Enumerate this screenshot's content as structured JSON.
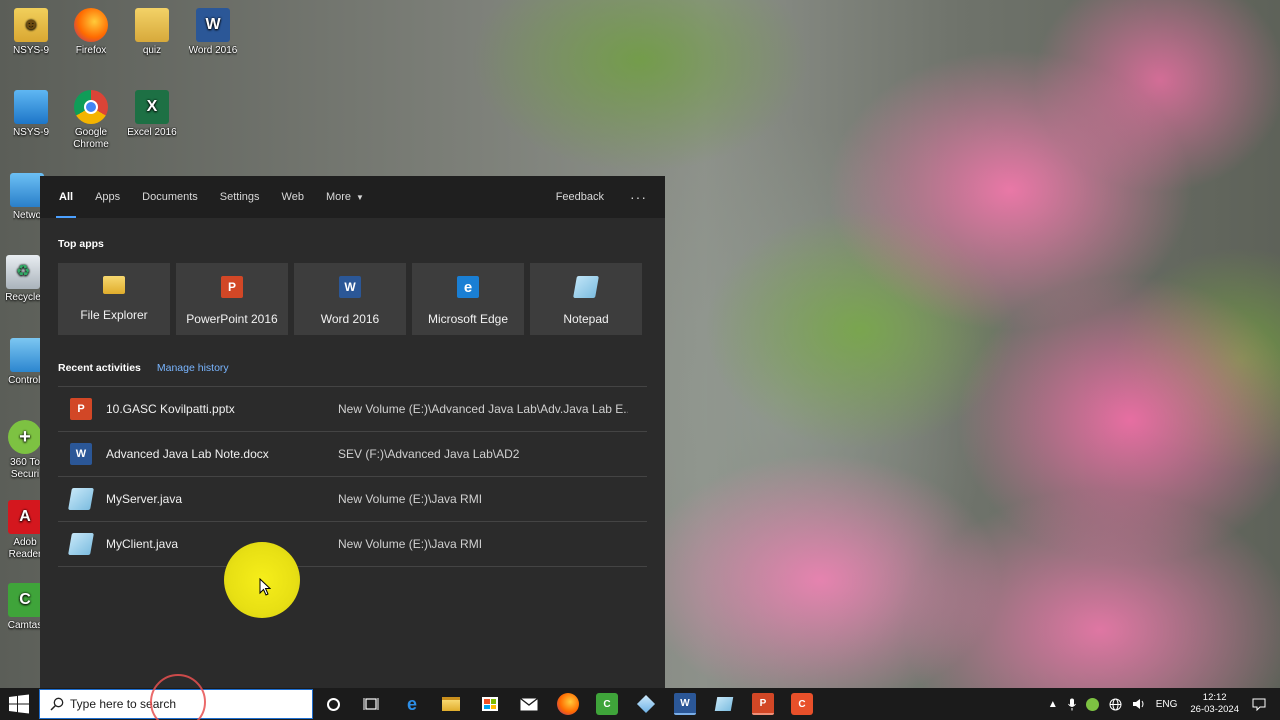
{
  "desktop": {
    "icons": [
      {
        "label": "NSYS-9",
        "icon": "user-folder-icon"
      },
      {
        "label": "Firefox",
        "icon": "firefox-icon"
      },
      {
        "label": "quiz",
        "icon": "folder-icon"
      },
      {
        "label": "Word 2016",
        "icon": "word-icon"
      },
      {
        "label": "NSYS-9",
        "icon": "this-pc-icon"
      },
      {
        "label": "Google Chrome",
        "icon": "chrome-icon"
      },
      {
        "label": "Excel 2016",
        "icon": "excel-icon"
      },
      {
        "label": "Netwo",
        "icon": "network-icon"
      },
      {
        "label": "Recycle",
        "icon": "recycle-bin-icon"
      },
      {
        "label": "Control I",
        "icon": "control-panel-icon"
      },
      {
        "label": "360 To Securi",
        "icon": "360-security-icon"
      },
      {
        "label": "Adob Reader",
        "icon": "adobe-reader-icon"
      },
      {
        "label": "Camtas",
        "icon": "camtasia-icon"
      }
    ]
  },
  "search_panel": {
    "tabs": [
      "All",
      "Apps",
      "Documents",
      "Settings",
      "Web",
      "More"
    ],
    "feedback": "Feedback",
    "more_options": "···",
    "top_apps_title": "Top apps",
    "top_apps": [
      {
        "label": "File Explorer",
        "icon": "file-explorer-icon"
      },
      {
        "label": "PowerPoint 2016",
        "icon": "powerpoint-icon"
      },
      {
        "label": "Word 2016",
        "icon": "word-icon"
      },
      {
        "label": "Microsoft Edge",
        "icon": "edge-icon"
      },
      {
        "label": "Notepad",
        "icon": "notepad-icon"
      }
    ],
    "recent_title": "Recent activities",
    "manage_history": "Manage history",
    "recent": [
      {
        "name": "10.GASC Kovilpatti.pptx",
        "path": "New Volume (E:)\\Advanced Java Lab\\Adv.Java Lab E...",
        "icon": "powerpoint-icon"
      },
      {
        "name": "Advanced Java Lab Note.docx",
        "path": "SEV (F:)\\Advanced Java Lab\\AD2",
        "icon": "word-icon"
      },
      {
        "name": "MyServer.java",
        "path": "New Volume (E:)\\Java RMI",
        "icon": "notepad-icon"
      },
      {
        "name": "MyClient.java",
        "path": "New Volume (E:)\\Java RMI",
        "icon": "notepad-icon"
      }
    ]
  },
  "taskbar": {
    "search_placeholder": "Type here to search",
    "language": "ENG",
    "time": "12:12",
    "date": "26-03-2024"
  },
  "colors": {
    "accent": "#4ba0ff",
    "panel_bg": "#2b2b2b",
    "tile_bg": "#3d3d3d",
    "taskbar_bg": "#1b1b1b"
  }
}
